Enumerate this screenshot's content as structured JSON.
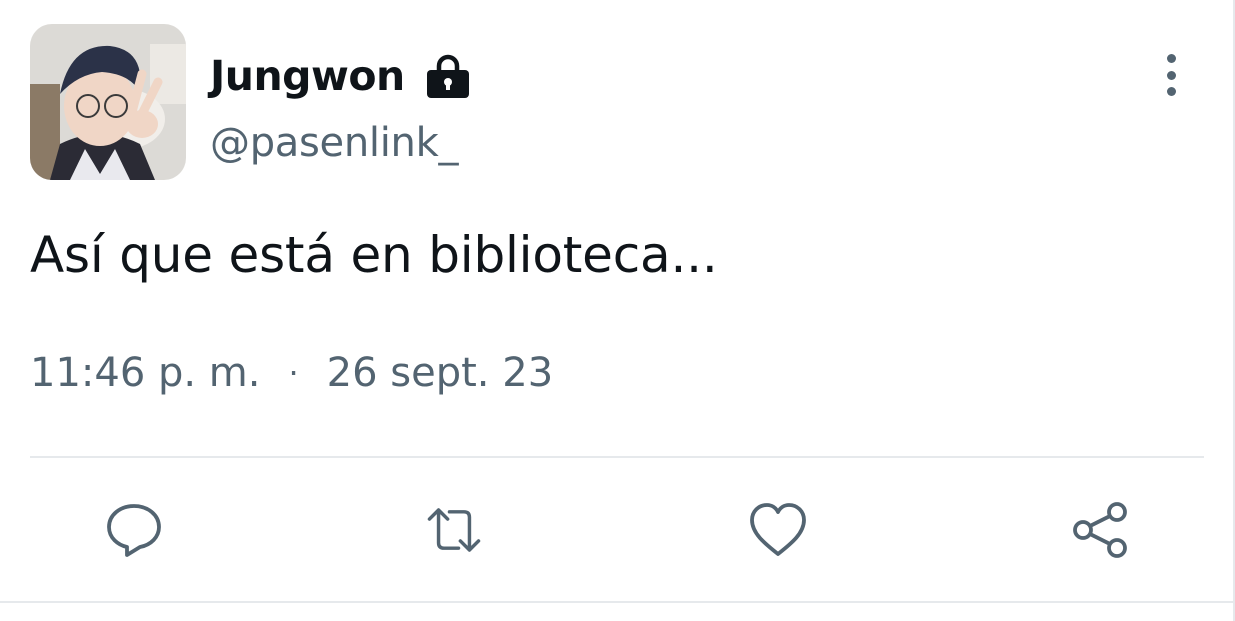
{
  "author": {
    "display_name": "Jungwon",
    "handle": "@pasenlink_",
    "protected_icon": "lock-icon",
    "avatar": "avatar-photo"
  },
  "tweet": {
    "text": "Así que está en biblioteca...",
    "time": "11:46 p. m.",
    "separator": "·",
    "date": "26 sept. 23"
  },
  "actions": {
    "reply_icon": "reply-icon",
    "retweet_icon": "retweet-icon",
    "like_icon": "heart-icon",
    "share_icon": "share-icon",
    "more_icon": "more-vertical-icon"
  },
  "colors": {
    "text_primary": "#0f1419",
    "text_secondary": "#536471",
    "divider": "#e6e9ec"
  }
}
